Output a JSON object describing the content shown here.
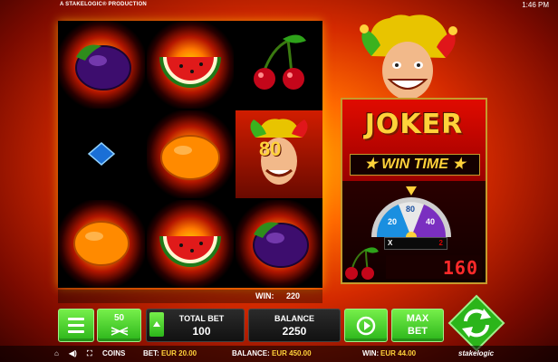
{
  "header": {
    "producer": "A STAKELOGIC® PRODUCTION",
    "clock": "1:46 PM"
  },
  "reels": {
    "symbols": [
      [
        "plum",
        "watermelon",
        "cherries"
      ],
      [
        "diamond",
        "orange",
        "joker-80"
      ],
      [
        "orange",
        "watermelon",
        "plum"
      ]
    ],
    "joker_multiplier": "80"
  },
  "win": {
    "label": "WIN:",
    "value": "220"
  },
  "feature": {
    "title": "JOKER",
    "subtitle": "WIN TIME",
    "wheel_numbers": [
      "20",
      "80",
      "40"
    ],
    "counter_prefix": "X",
    "counter_value": "2",
    "display_value": "160"
  },
  "controls": {
    "lines_value": "50",
    "total_bet_label": "TOTAL BET",
    "total_bet_value": "100",
    "balance_label": "BALANCE",
    "balance_value": "2250",
    "maxbet_line1": "MAX",
    "maxbet_line2": "BET"
  },
  "footer": {
    "coins_label": "COINS",
    "bet_label": "BET:",
    "bet_value": "EUR  20.00",
    "balance_label": "BALANCE:",
    "balance_value": "EUR  450.00",
    "win_label": "WIN:",
    "win_value": "EUR  44.00",
    "brand": "stakelogic"
  },
  "colors": {
    "accent_green": "#2bb51a",
    "gold": "#ffd23a",
    "display_red": "#ff2a2a"
  }
}
